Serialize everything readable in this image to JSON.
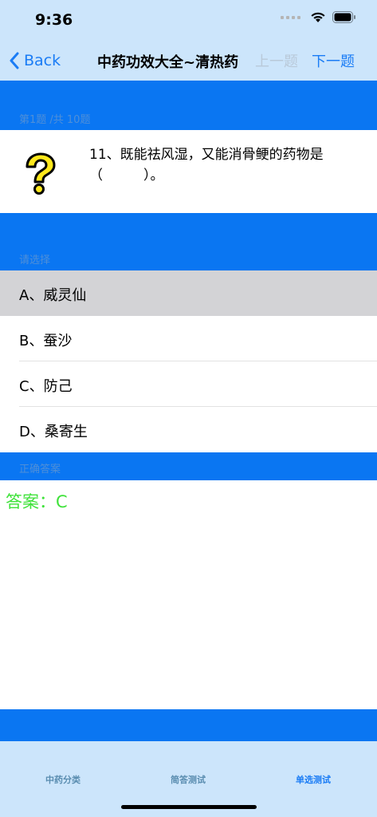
{
  "status_bar": {
    "time": "9:36"
  },
  "nav": {
    "back_label": "Back",
    "title": "中药功效大全~清热药",
    "prev_label": "上一题",
    "next_label": "下一题"
  },
  "question": {
    "progress": "第1题 /共 10题",
    "text": "11、既能祛风湿，又能消骨鲠的药物是（　　　）。"
  },
  "options_header": "请选择",
  "options": [
    {
      "label": "A、威灵仙",
      "selected": true
    },
    {
      "label": "B、蚕沙",
      "selected": false
    },
    {
      "label": "C、防己",
      "selected": false
    },
    {
      "label": "D、桑寄生",
      "selected": false
    }
  ],
  "answer_header": "正确答案",
  "answer_text": "答案：C",
  "tabs": [
    {
      "label": "中药分类",
      "active": false
    },
    {
      "label": "简答测试",
      "active": false
    },
    {
      "label": "单选测试",
      "active": true
    }
  ],
  "colors": {
    "nav_background": "#cce5fb",
    "band_blue": "#0a76f2",
    "accent": "#1a7cf5",
    "answer_green": "#3fe23a",
    "selected_row": "#d3d3d6"
  },
  "icons": {
    "question": "question-mark-icon",
    "back": "chevron-left-icon"
  }
}
